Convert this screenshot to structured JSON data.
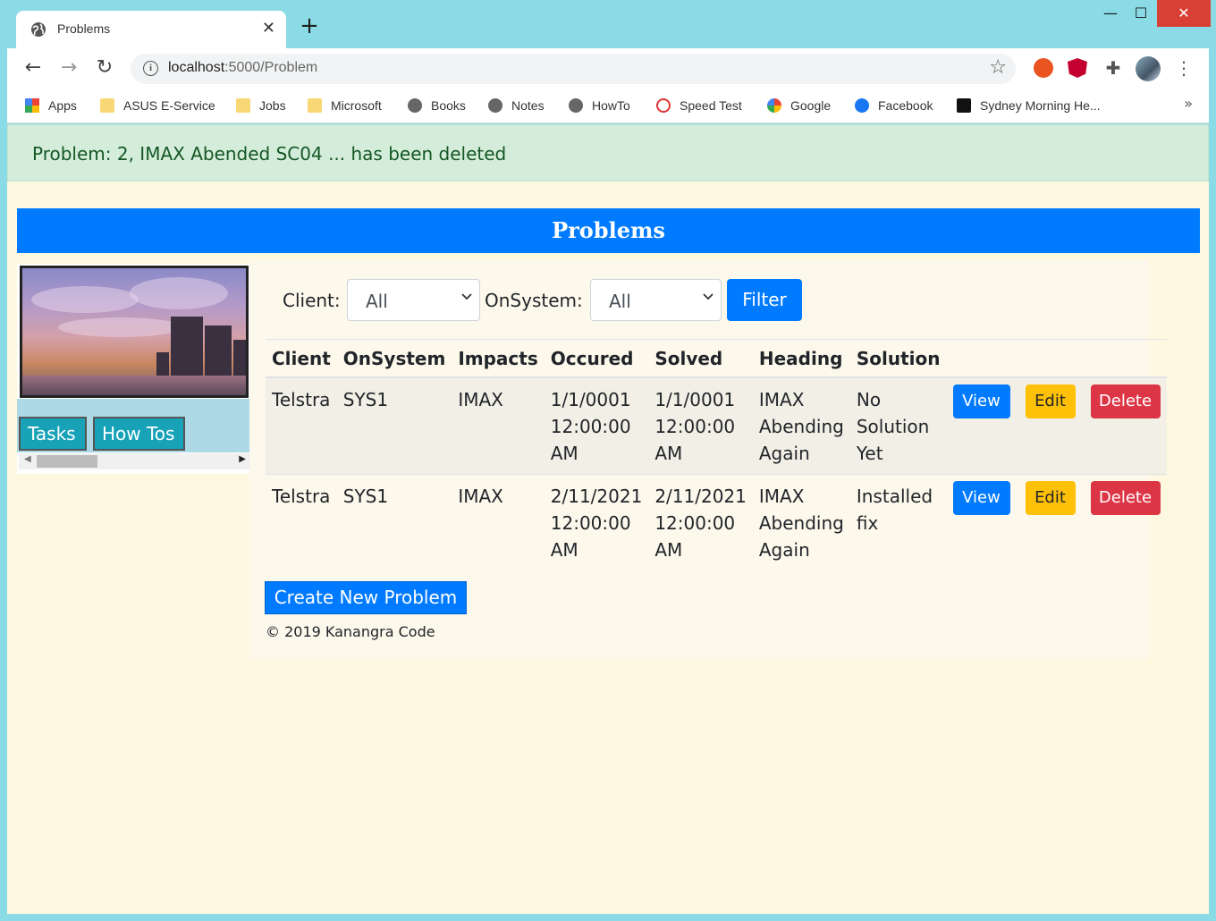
{
  "browser": {
    "tab_title": "Problems",
    "tab_close": "✕",
    "new_tab": "+",
    "url_host": "localhost",
    "url_path": ":5000/Problem",
    "window_controls": {
      "minimize": "—",
      "maximize": "☐",
      "close": "✕"
    },
    "bookmarks": [
      {
        "label": "Apps",
        "icon": "apps-grid-icon"
      },
      {
        "label": "ASUS E-Service",
        "icon": "folder-icon"
      },
      {
        "label": "Jobs",
        "icon": "folder-icon"
      },
      {
        "label": "Microsoft",
        "icon": "folder-icon"
      },
      {
        "label": "Books",
        "icon": "globe-icon"
      },
      {
        "label": "Notes",
        "icon": "globe-icon"
      },
      {
        "label": "HowTo",
        "icon": "globe-icon"
      },
      {
        "label": "Speed Test",
        "icon": "speedometer-icon"
      },
      {
        "label": "Google",
        "icon": "google-icon"
      },
      {
        "label": "Facebook",
        "icon": "facebook-icon"
      },
      {
        "label": "Sydney Morning He...",
        "icon": "smh-icon"
      }
    ],
    "bookmarks_more": "»"
  },
  "alert": {
    "message": "Problem: 2, IMAX Abended SC04 ... has been deleted",
    "color": "#155724",
    "background": "#d4edda"
  },
  "header": {
    "title": "Problems",
    "background": "#007bff"
  },
  "sidebar": {
    "tasks_label": "Tasks",
    "howtos_label": "How Tos"
  },
  "filter": {
    "client_label": "Client:",
    "client_value": "All",
    "onsystem_label": "OnSystem:",
    "onsystem_value": "All",
    "filter_label": "Filter"
  },
  "table": {
    "headers": [
      "Client",
      "OnSystem",
      "Impacts",
      "Occured",
      "Solved",
      "Heading",
      "Solution"
    ],
    "rows": [
      {
        "client": "Telstra",
        "onsystem": "SYS1",
        "impacts": "IMAX",
        "occured": [
          "1/1/0001",
          "12:00:00",
          "AM"
        ],
        "solved": [
          "1/1/0001",
          "12:00:00",
          "AM"
        ],
        "heading": [
          "IMAX",
          "Abending",
          "Again"
        ],
        "solution": [
          "No",
          "Solution",
          "Yet"
        ]
      },
      {
        "client": "Telstra",
        "onsystem": "SYS1",
        "impacts": "IMAX",
        "occured": [
          "2/11/2021",
          "12:00:00",
          "AM"
        ],
        "solved": [
          "2/11/2021",
          "12:00:00",
          "AM"
        ],
        "heading": [
          "IMAX",
          "Abending",
          "Again"
        ],
        "solution": [
          "Installed",
          "fix"
        ]
      }
    ],
    "actions": {
      "view": "View",
      "edit": "Edit",
      "delete": "Delete"
    }
  },
  "create_label": "Create New Problem",
  "footer": "© 2019 Kanangra Code",
  "colors": {
    "primary": "#007bff",
    "warning": "#ffc107",
    "danger": "#dc3545",
    "info": "#17a2b8",
    "page_bg": "#fff8e1",
    "sidebar_menu_bg": "#add8e6"
  }
}
